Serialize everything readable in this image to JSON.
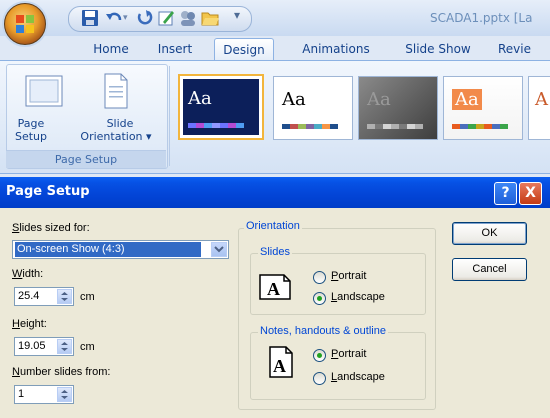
{
  "window": {
    "title": "SCADA1.pptx [La"
  },
  "tabs": [
    "Home",
    "Insert",
    "Design",
    "Animations",
    "Slide Show",
    "Revie"
  ],
  "active_tab": "Design",
  "ribbon": {
    "page_setup_group": {
      "page_setup_label_1": "Page",
      "page_setup_label_2": "Setup",
      "slide_orientation_label_1": "Slide",
      "slide_orientation_label_2": "Orientation",
      "title": "Page Setup"
    },
    "themes": [
      {
        "label": "Aa",
        "style": "dark-blue"
      },
      {
        "label": "Aa",
        "style": "white"
      },
      {
        "label": "Aa",
        "style": "gray"
      },
      {
        "label": "Aa",
        "style": "orange"
      },
      {
        "label": "A",
        "style": "partial"
      }
    ]
  },
  "dialog": {
    "title": "Page Setup",
    "help_label": "?",
    "close_label": "X",
    "slides_sized_for": {
      "label_prefix": "S",
      "label_rest": "lides sized for:",
      "value": "On-screen Show (4:3)"
    },
    "width": {
      "label_prefix": "W",
      "label_rest": "idth:",
      "value": "25.4",
      "unit": "cm"
    },
    "height": {
      "label_prefix": "H",
      "label_rest": "eight:",
      "value": "19.05",
      "unit": "cm"
    },
    "number_slides_from": {
      "label_prefix": "N",
      "label_rest": "umber slides from:",
      "value": "1"
    },
    "orientation": {
      "legend": "Orientation",
      "slides": {
        "legend": "Slides",
        "portrait_prefix": "P",
        "portrait_rest": "ortrait",
        "landscape_prefix": "L",
        "landscape_rest": "andscape",
        "selected": "Landscape"
      },
      "notes": {
        "legend": "Notes, handouts & outline",
        "portrait_prefix": "P",
        "portrait_rest": "ortrait",
        "landscape_prefix": "L",
        "landscape_rest": "andscape",
        "selected": "Portrait"
      }
    },
    "ok_label": "OK",
    "cancel_label": "Cancel"
  }
}
